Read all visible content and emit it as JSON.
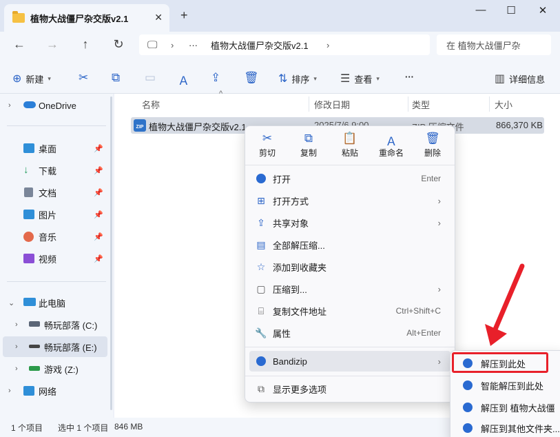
{
  "window": {
    "tab_title": "植物大战僵尸杂交版v2.1",
    "tab_close": "✕",
    "new_tab": "+",
    "min": "—",
    "max": "☐",
    "close": "✕"
  },
  "address": {
    "breadcrumb_more": "···",
    "breadcrumb_sep": "›",
    "current": "植物大战僵尸杂交版v2.1",
    "search_placeholder": "在 植物大战僵尸杂"
  },
  "toolbar": {
    "new_label": "新建",
    "sort_label": "排序",
    "view_label": "查看",
    "more": "···",
    "details_label": "详细信息"
  },
  "sidebar": {
    "onedrive": "OneDrive",
    "quick": [
      {
        "label": "桌面",
        "color": "#2f8fd8"
      },
      {
        "label": "下载",
        "color": "#1f9a5a"
      },
      {
        "label": "文档",
        "color": "#7a8699"
      },
      {
        "label": "图片",
        "color": "#2f8fd8"
      },
      {
        "label": "音乐",
        "color": "#e3694b"
      },
      {
        "label": "视频",
        "color": "#8b4fd6"
      }
    ],
    "this_pc": "此电脑",
    "drives": [
      {
        "label": "畅玩部落 (C:)"
      },
      {
        "label": "畅玩部落 (E:)"
      },
      {
        "label": "游戏 (Z:)"
      }
    ],
    "network": "网络"
  },
  "columns": {
    "name": "名称",
    "modified": "修改日期",
    "type": "类型",
    "size": "大小"
  },
  "file": {
    "name": "植物大战僵尸杂交版v2.1",
    "modified": "2025/7/6 9:00",
    "type": "ZIP 压缩文件",
    "size": "866,370 KB"
  },
  "context_menu": {
    "top": [
      {
        "label": "剪切",
        "icon": "✂"
      },
      {
        "label": "复制",
        "icon": "⧉"
      },
      {
        "label": "粘贴",
        "icon": "📋"
      },
      {
        "label": "重命名",
        "icon": "Ａ"
      },
      {
        "label": "删除",
        "icon": "🗑"
      }
    ],
    "items": [
      {
        "label": "打开",
        "shortcut": "Enter"
      },
      {
        "label": "打开方式",
        "arrow": "›"
      },
      {
        "label": "共享对象",
        "arrow": "›"
      },
      {
        "label": "全部解压缩..."
      },
      {
        "label": "添加到收藏夹"
      },
      {
        "label": "压缩到...",
        "arrow": "›"
      },
      {
        "label": "复制文件地址",
        "shortcut": "Ctrl+Shift+C"
      },
      {
        "label": "属性",
        "shortcut": "Alt+Enter"
      },
      {
        "label": "Bandizip",
        "arrow": "›"
      },
      {
        "label": "显示更多选项"
      }
    ]
  },
  "submenu": {
    "items": [
      {
        "label": "解压到此处"
      },
      {
        "label": "智能解压到此处"
      },
      {
        "label": "解压到 植物大战僵"
      },
      {
        "label": "解压到其他文件夹..."
      }
    ]
  },
  "status": {
    "count": "1 个项目",
    "selected": "选中 1 个项目",
    "size": "846 MB"
  },
  "accent": "#2b64c7",
  "highlight_color": "#e8202a"
}
